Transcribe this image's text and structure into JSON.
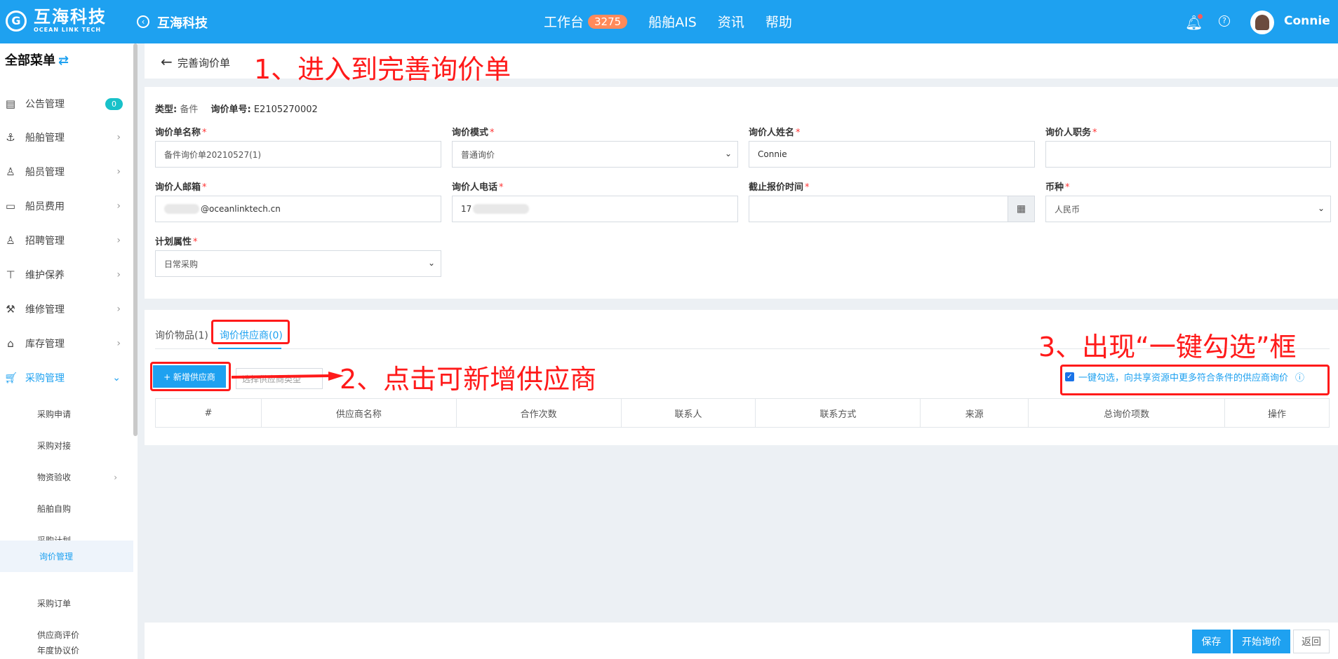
{
  "header": {
    "logo_cn": "互海科技",
    "logo_en": "OCEAN LINK TECH",
    "company": "互海科技",
    "nav": [
      {
        "label": "工作台",
        "badge": "3275"
      },
      {
        "label": "船舶AIS"
      },
      {
        "label": "资讯"
      },
      {
        "label": "帮助"
      }
    ],
    "username": "Connie"
  },
  "sidebar": {
    "title": "全部菜单",
    "items": [
      {
        "label": "公告管理",
        "icon": "book-icon",
        "badge": "0"
      },
      {
        "label": "船舶管理",
        "icon": "anchor-icon"
      },
      {
        "label": "船员管理",
        "icon": "person-icon"
      },
      {
        "label": "船员费用",
        "icon": "wallet-icon"
      },
      {
        "label": "招聘管理",
        "icon": "person-add-icon"
      },
      {
        "label": "维护保养",
        "icon": "hammer-icon"
      },
      {
        "label": "维修管理",
        "icon": "wrench-icon"
      },
      {
        "label": "库存管理",
        "icon": "home-icon"
      },
      {
        "label": "采购管理",
        "icon": "cart-icon"
      }
    ],
    "subitems": [
      "采购申请",
      "采购对接",
      "物资验收",
      "船舶自购",
      "采购计划",
      "询价管理",
      "采购订单",
      "供应商评价",
      "年度协议价"
    ]
  },
  "page": {
    "title": "完善询价单"
  },
  "form": {
    "type_label": "类型:",
    "type_value": "备件",
    "no_label": "询价单号:",
    "no_value": "E2105270002",
    "fields": {
      "name": {
        "label": "询价单名称",
        "value": "备件询价单20210527(1)"
      },
      "mode": {
        "label": "询价模式",
        "value": "普通询价"
      },
      "person": {
        "label": "询价人姓名",
        "value": "Connie"
      },
      "position": {
        "label": "询价人职务",
        "value": ""
      },
      "email": {
        "label": "询价人邮箱",
        "value": "@oceanlinktech.cn"
      },
      "phone": {
        "label": "询价人电话",
        "value": "17"
      },
      "deadline": {
        "label": "截止报价时间",
        "value": ""
      },
      "currency": {
        "label": "币种",
        "value": "人民币"
      },
      "plan": {
        "label": "计划属性",
        "value": "日常采购"
      }
    }
  },
  "tabs": [
    {
      "label": "询价物品(1)"
    },
    {
      "label": "询价供应商(0)"
    }
  ],
  "supplier": {
    "add_button": "+ 新增供应商",
    "type_placeholder": "选择供应商类型",
    "onekey_text": "一键勾选，向共享资源中更多符合条件的供应商询价",
    "columns": [
      "#",
      "供应商名称",
      "合作次数",
      "联系人",
      "联系方式",
      "来源",
      "总询价项数",
      "操作"
    ]
  },
  "annotations": {
    "step1": "1、进入到完善询价单",
    "step2": "2、点击可新增供应商",
    "step3": "3、出现“一键勾选”框"
  },
  "footer": {
    "save": "保存",
    "start": "开始询价",
    "back": "返回"
  }
}
